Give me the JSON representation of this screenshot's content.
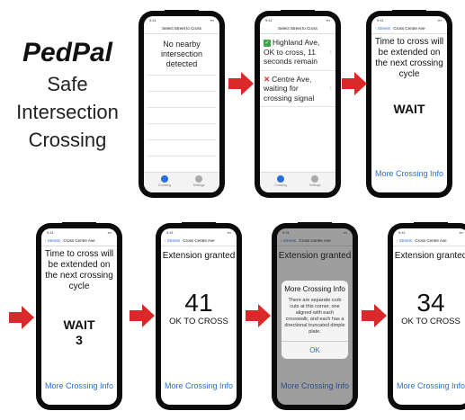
{
  "brand": {
    "title": "PedPal",
    "subtitle_lines": [
      "Safe",
      "Intersection",
      "Crossing"
    ]
  },
  "colors": {
    "arrow": "#d9292a",
    "link": "#2a6fd8",
    "check": "#3aa845",
    "x": "#e0322a"
  },
  "screens": {
    "s1": {
      "nav_title": "Select Street to Cross",
      "message": "No nearby intersection detected",
      "tabs": [
        "Crossing",
        "Settings"
      ]
    },
    "s2": {
      "nav_title": "Select Street to Cross",
      "items": [
        {
          "icon": "check-icon",
          "text": "Highland Ave, OK to cross, 11 seconds remain"
        },
        {
          "icon": "x-icon",
          "text": "Centre Ave, waiting for crossing signal"
        }
      ],
      "tabs": [
        "Crossing",
        "Settings"
      ]
    },
    "s3": {
      "back": "Streets",
      "nav_title": "Cross Centre Ave",
      "message": "Time to cross will be extended on the next crossing cycle",
      "status": "WAIT",
      "more": "More Crossing Info"
    },
    "s4": {
      "back": "Streets",
      "nav_title": "Cross Centre Ave",
      "message": "Time to cross will be extended on the next crossing cycle",
      "status": "WAIT",
      "count": "3",
      "more": "More Crossing Info"
    },
    "s5": {
      "back": "Streets",
      "nav_title": "Cross Centre Ave",
      "extension": "Extension granted",
      "count": "41",
      "ok": "OK TO CROSS",
      "more": "More Crossing Info"
    },
    "s6": {
      "back": "Streets",
      "nav_title": "Cross Centre Ave",
      "extension": "Extension granted",
      "alert_title": "More Crossing Info",
      "alert_body": "There are separate curb cuts at this corner, one aligned with each crosswalk; and each has a directional truncated dimple plate.",
      "alert_ok": "OK",
      "more": "More Crossing Info"
    },
    "s7": {
      "back": "Streets",
      "nav_title": "Cross Centre Ave",
      "extension": "Extension granted",
      "count": "34",
      "ok": "OK TO CROSS",
      "more": "More Crossing Info"
    }
  }
}
